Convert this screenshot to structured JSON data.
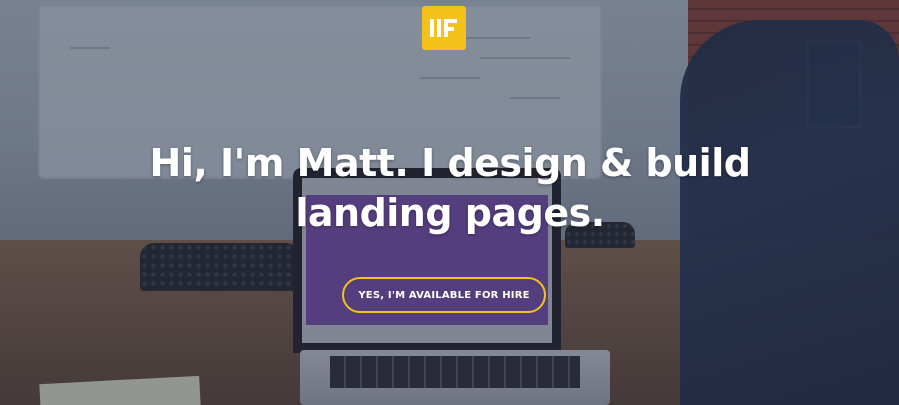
{
  "brand": {
    "logo_icon": "mf-monogram-logo-icon",
    "logo_color": "#f4c21b"
  },
  "hero": {
    "headline_line1": "Hi, I'm Matt. I design & build",
    "headline_line2": "landing pages.",
    "cta_label": "YES, I'M AVAILABLE FOR HIRE",
    "cta_border_color": "#f4c21b",
    "text_color": "#ffffff"
  }
}
